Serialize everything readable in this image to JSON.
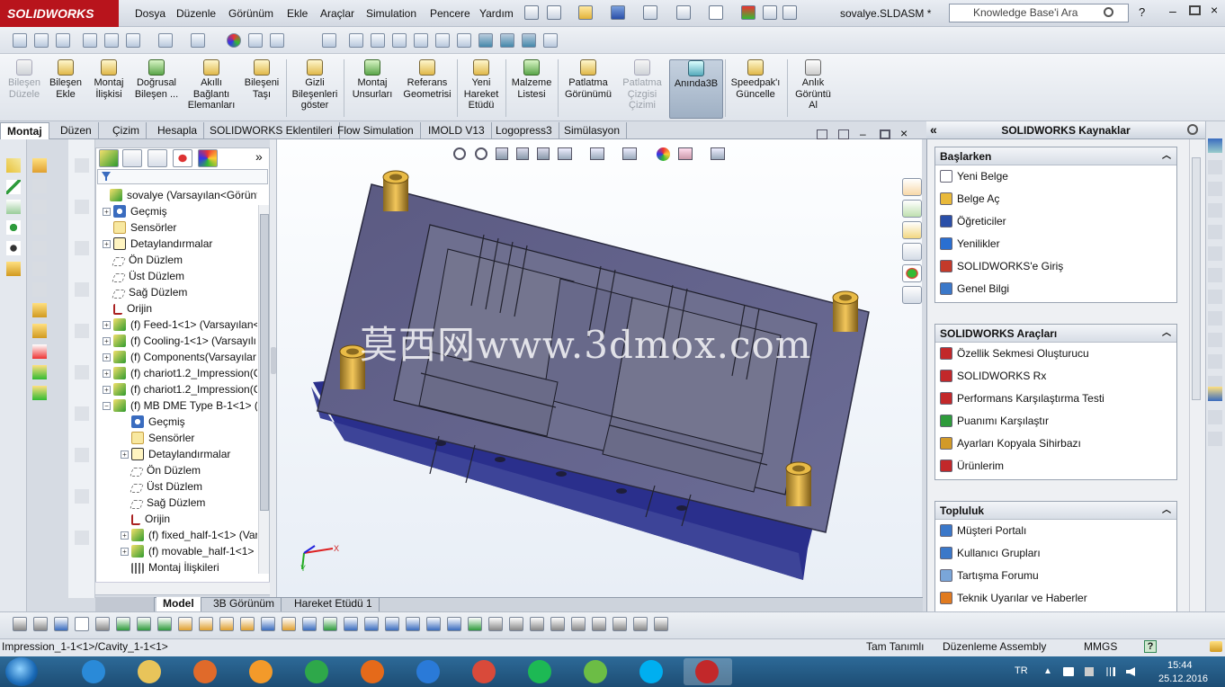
{
  "app": {
    "brand": "SOLIDWORKS",
    "doc_title": "sovalye.SLDASM *",
    "search_placeholder": "Knowledge Base'i Ara"
  },
  "menu": [
    "Dosya",
    "Düzenle",
    "Görünüm",
    "Ekle",
    "Araçlar",
    "Simulation",
    "Pencere",
    "Yardım"
  ],
  "commands": [
    {
      "label": "Bileşen\nDüzele",
      "state": "disabled"
    },
    {
      "label": "Bileşen\nEkle",
      "state": "normal"
    },
    {
      "label": "Montaj\nİlişkisi",
      "state": "normal"
    },
    {
      "label": "Doğrusal\nBileşen ...",
      "state": "normal"
    },
    {
      "label": "Akıllı\nBağlantı\nElemanları",
      "state": "normal"
    },
    {
      "label": "Bileşeni\nTaşı",
      "state": "normal"
    },
    {
      "label": "Gizli\nBileşenleri\ngöster",
      "state": "normal"
    },
    {
      "label": "Montaj\nUnsurları",
      "state": "normal"
    },
    {
      "label": "Referans\nGeometrisi",
      "state": "normal"
    },
    {
      "label": "Yeni\nHareket\nEtüdü",
      "state": "normal"
    },
    {
      "label": "Malzeme\nListesi",
      "state": "normal"
    },
    {
      "label": "Patlatma\nGörünümü",
      "state": "normal"
    },
    {
      "label": "Patlatma\nÇizgisi\nÇizimi",
      "state": "disabled"
    },
    {
      "label": "Anında3B",
      "state": "active"
    },
    {
      "label": "Speedpak'ı\nGüncelle",
      "state": "normal"
    },
    {
      "label": "Anlık\nGörüntü\nAl",
      "state": "normal"
    }
  ],
  "tabs": [
    "Montaj",
    "Düzen",
    "Çizim",
    "Hesapla",
    "SOLIDWORKS Eklentileri",
    "Flow Simulation",
    "IMOLD V13",
    "Logopress3",
    "Simülasyon"
  ],
  "tree": [
    {
      "label": "sovalye  (Varsayılan<Görüntü",
      "level": 0,
      "icon": "asm",
      "exp": ""
    },
    {
      "label": "Geçmiş",
      "level": 1,
      "icon": "hist",
      "exp": "+"
    },
    {
      "label": "Sensörler",
      "level": 1,
      "icon": "sens",
      "exp": ""
    },
    {
      "label": "Detaylandırmalar",
      "level": 1,
      "icon": "ann",
      "exp": "+"
    },
    {
      "label": "Ön Düzlem",
      "level": 1,
      "icon": "pl",
      "exp": ""
    },
    {
      "label": "Üst Düzlem",
      "level": 1,
      "icon": "pl",
      "exp": ""
    },
    {
      "label": "Sağ Düzlem",
      "level": 1,
      "icon": "pl",
      "exp": ""
    },
    {
      "label": "Orijin",
      "level": 1,
      "icon": "org",
      "exp": ""
    },
    {
      "label": "(f) Feed-1<1> (Varsayılan<",
      "level": 1,
      "icon": "asm",
      "exp": "+"
    },
    {
      "label": "(f) Cooling-1<1> (Varsayılı",
      "level": 1,
      "icon": "asm",
      "exp": "+"
    },
    {
      "label": "(f) Components(Varsayılar",
      "level": 1,
      "icon": "asm",
      "exp": "+"
    },
    {
      "label": "(f) chariot1.2_Impression(C",
      "level": 1,
      "icon": "asm",
      "exp": "+"
    },
    {
      "label": "(f) chariot1.2_Impression(C",
      "level": 1,
      "icon": "asm",
      "exp": "+"
    },
    {
      "label": "(f) MB DME Type B-1<1> (",
      "level": 1,
      "icon": "asm",
      "exp": "−"
    },
    {
      "label": "Geçmiş",
      "level": 2,
      "icon": "hist",
      "exp": ""
    },
    {
      "label": "Sensörler",
      "level": 2,
      "icon": "sens",
      "exp": ""
    },
    {
      "label": "Detaylandırmalar",
      "level": 2,
      "icon": "ann",
      "exp": "+"
    },
    {
      "label": "Ön Düzlem",
      "level": 2,
      "icon": "pl",
      "exp": ""
    },
    {
      "label": "Üst Düzlem",
      "level": 2,
      "icon": "pl",
      "exp": ""
    },
    {
      "label": "Sağ Düzlem",
      "level": 2,
      "icon": "pl",
      "exp": ""
    },
    {
      "label": "Orijin",
      "level": 2,
      "icon": "org",
      "exp": ""
    },
    {
      "label": "(f) fixed_half-1<1> (Var",
      "level": 2,
      "icon": "asm",
      "exp": "+"
    },
    {
      "label": "(f) movable_half-1<1>",
      "level": 2,
      "icon": "asm",
      "exp": "+"
    },
    {
      "label": "Montaj İlişkileri",
      "level": 2,
      "icon": "mate",
      "exp": ""
    }
  ],
  "viewport": {
    "watermark": "莫西网www.3dmox.com",
    "triad_x": "X",
    "triad_y": "Y"
  },
  "bottom_tabs": [
    "Model",
    "3B Görünüm",
    "Hareket Etüdü 1"
  ],
  "resources": {
    "title": "SOLIDWORKS Kaynaklar",
    "groups": [
      {
        "title": "Başlarken",
        "items": [
          {
            "label": "Yeni Belge",
            "icon": "doc",
            "color": "#ffffff"
          },
          {
            "label": "Belge Aç",
            "icon": "folder",
            "color": "#e9b93a"
          },
          {
            "label": "Öğreticiler",
            "icon": "cap",
            "color": "#2a4fa8"
          },
          {
            "label": "Yenilikler",
            "icon": "new",
            "color": "#2a6fd1"
          },
          {
            "label": "SOLIDWORKS'e Giriş",
            "icon": "box",
            "color": "#c43a2a"
          },
          {
            "label": "Genel Bilgi",
            "icon": "info",
            "color": "#3b78c9"
          }
        ]
      },
      {
        "title": "SOLIDWORKS Araçları",
        "items": [
          {
            "label": "Özellik Sekmesi Oluşturucu",
            "icon": "tool",
            "color": "#c2282a"
          },
          {
            "label": "SOLIDWORKS Rx",
            "icon": "rx",
            "color": "#c2282a"
          },
          {
            "label": "Performans Karşılaştırma Testi",
            "icon": "perf",
            "color": "#c2282a"
          },
          {
            "label": "Puanımı Karşılaştır",
            "icon": "score",
            "color": "#2e9b3b"
          },
          {
            "label": "Ayarları Kopyala Sihirbazı",
            "icon": "wand",
            "color": "#d29a28"
          },
          {
            "label": "Ürünlerim",
            "icon": "prod",
            "color": "#c2282a"
          }
        ]
      },
      {
        "title": "Topluluk",
        "items": [
          {
            "label": "Müşteri Portalı",
            "icon": "globe",
            "color": "#3b78c9"
          },
          {
            "label": "Kullanıcı Grupları",
            "icon": "users",
            "color": "#3b78c9"
          },
          {
            "label": "Tartışma Forumu",
            "icon": "forum",
            "color": "#7aa6d9"
          },
          {
            "label": "Teknik Uyarılar ve Haberler",
            "icon": "rss",
            "color": "#e07a1f"
          }
        ]
      }
    ]
  },
  "status": {
    "left": "Impression_1-1<1>/Cavity_1-1<1>",
    "defined": "Tam Tanımlı",
    "mode": "Düzenleme Assembly",
    "units": "MMGS",
    "help": "?"
  },
  "taskbar": {
    "lang": "TR",
    "time": "15:44",
    "date": "25.12.2016",
    "apps": [
      {
        "name": "ie-icon",
        "color": "#2a8ad8"
      },
      {
        "name": "file-explorer-icon",
        "color": "#e8c45a"
      },
      {
        "name": "media-player-icon",
        "color": "#e06a2a"
      },
      {
        "name": "orange-app-icon",
        "color": "#f39a2a"
      },
      {
        "name": "download-arrow-icon",
        "color": "#2ea84a"
      },
      {
        "name": "firefox-icon",
        "color": "#e56a1a"
      },
      {
        "name": "teamviewer-icon",
        "color": "#2a7ad8"
      },
      {
        "name": "chrome-icon",
        "color": "#d94a3a"
      },
      {
        "name": "spotify-icon",
        "color": "#1db954"
      },
      {
        "name": "utorrent-icon",
        "color": "#6cbd45"
      },
      {
        "name": "skype-icon",
        "color": "#00aff0"
      },
      {
        "name": "solidworks-2015-icon",
        "color": "#c2282a"
      }
    ]
  }
}
